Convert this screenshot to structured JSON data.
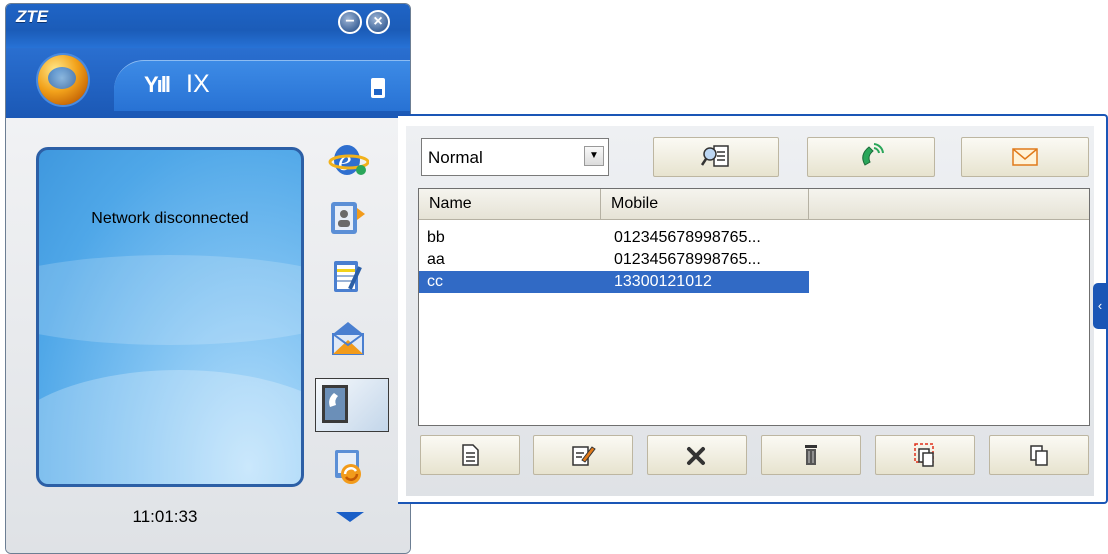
{
  "app": {
    "logo": "ZTE",
    "window_buttons": {
      "minimize": "−",
      "close": "×"
    }
  },
  "header": {
    "signal_icon": "Yıll",
    "network_type": "IX",
    "sim_icon": "sim-card-icon"
  },
  "screen": {
    "status": "Network disconnected",
    "time": "11:01:33"
  },
  "side_menu": [
    {
      "icon": "internet-icon"
    },
    {
      "icon": "contacts-icon"
    },
    {
      "icon": "notes-icon"
    },
    {
      "icon": "sms-icon"
    },
    {
      "icon": "call-icon"
    },
    {
      "icon": "sync-icon"
    }
  ],
  "phonebook": {
    "group_select": {
      "value": "Normal"
    },
    "toolbar": [
      {
        "icon": "search-contact-icon"
      },
      {
        "icon": "dial-icon"
      },
      {
        "icon": "message-icon"
      }
    ],
    "columns": [
      "Name",
      "Mobile"
    ],
    "rows": [
      {
        "name": "bb",
        "mobile": "012345678998765...",
        "selected": false
      },
      {
        "name": "aa",
        "mobile": "012345678998765...",
        "selected": false
      },
      {
        "name": "cc",
        "mobile": "13300121012",
        "selected": true
      }
    ],
    "bottom_buttons": [
      {
        "icon": "new-contact-icon"
      },
      {
        "icon": "edit-contact-icon"
      },
      {
        "icon": "delete-contact-icon"
      },
      {
        "icon": "delete-all-icon"
      },
      {
        "icon": "copy-selected-icon"
      },
      {
        "icon": "copy-icon"
      }
    ],
    "selection_color": "#316ac5",
    "accent_color": "#1a56b6"
  }
}
